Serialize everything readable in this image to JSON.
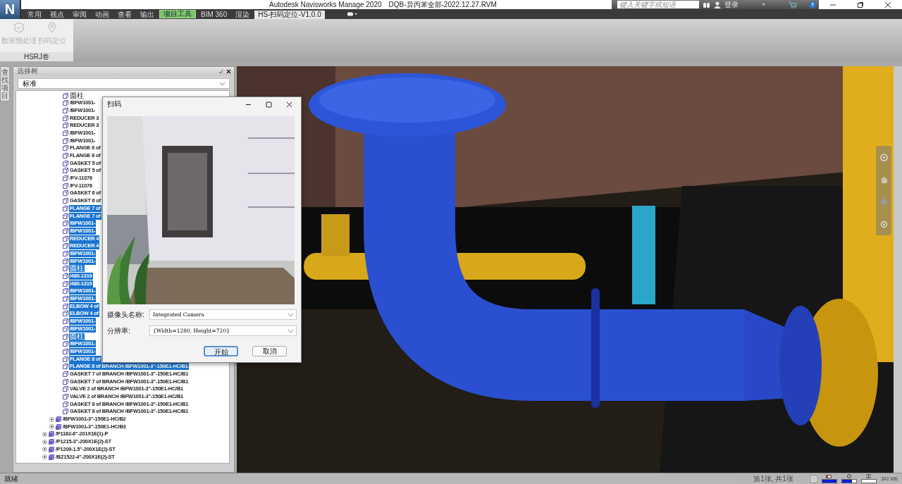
{
  "title_bar": {
    "logo": "N",
    "title": "Autodesk Navisworks Manage 2020",
    "document": "DQB-异丙苯全部-2022.12.27.RVM",
    "search": {
      "placeholder": "键入关键字或短语"
    },
    "sign_in": "登录",
    "help": "?"
  },
  "ribbon_tabs": [
    {
      "label": "常用",
      "selected": false,
      "highlighted": false
    },
    {
      "label": "视点",
      "selected": false,
      "highlighted": false
    },
    {
      "label": "审阅",
      "selected": false,
      "highlighted": false
    },
    {
      "label": "动画",
      "selected": false,
      "highlighted": false
    },
    {
      "label": "查看",
      "selected": false,
      "highlighted": false
    },
    {
      "label": "输出",
      "selected": false,
      "highlighted": false
    },
    {
      "label": "项目工具",
      "selected": false,
      "highlighted": true
    },
    {
      "label": "BIM 360",
      "selected": false,
      "highlighted": false
    },
    {
      "label": "渲染",
      "selected": false,
      "highlighted": false
    },
    {
      "label": "HS-扫码定位-V1.0.0",
      "selected": true,
      "highlighted": false
    }
  ],
  "ribbon": {
    "buttons": [
      {
        "label": "数据预处理",
        "disabled": true
      },
      {
        "label": "扫码定位",
        "disabled": true
      }
    ],
    "panel_label": "HSRJ卷"
  },
  "side_tab": "查找项目",
  "selection_tree": {
    "title": "选择树",
    "filter": "标准",
    "items": [
      {
        "children": [
          {
            "children": [
              {
                "label": "圆柱",
                "selected": false
              },
              {
                "label": "/BFW1001-",
                "selected": false
              },
              {
                "label": "/BFW1001-",
                "selected": false
              },
              {
                "label": "REDUCER 3",
                "selected": false
              },
              {
                "label": "REDUCER 3",
                "selected": false
              },
              {
                "label": "/BFW1001-",
                "selected": false
              },
              {
                "label": "/BFW1001-",
                "selected": false
              },
              {
                "label": "FLANGE 6 of",
                "selected": false
              },
              {
                "label": "FLANGE 6 of",
                "selected": false
              },
              {
                "label": "GASKET 5 of",
                "selected": false
              },
              {
                "label": "GASKET 5 of",
                "selected": false
              },
              {
                "label": "/FV-11076",
                "selected": false
              },
              {
                "label": "/FV-11076",
                "selected": false
              },
              {
                "label": "GASKET 6 of",
                "selected": false
              },
              {
                "label": "GASKET 6 of",
                "selected": false
              },
              {
                "label": "FLANGE 7 of",
                "selected": true
              },
              {
                "label": "FLANGE 7 of",
                "selected": true
              },
              {
                "label": "/BFW1001-",
                "selected": true
              },
              {
                "label": "/BFW1001-",
                "selected": true
              },
              {
                "label": "REDUCER 4",
                "selected": true
              },
              {
                "label": "REDUCER 4",
                "selected": true
              },
              {
                "label": "/BFW1001-",
                "selected": true
              },
              {
                "label": "/BFW1001-",
                "selected": true
              },
              {
                "label": "圆柱",
                "selected": true
              },
              {
                "label": "/480-1319",
                "selected": true
              },
              {
                "label": "/480-1319",
                "selected": true
              },
              {
                "label": "/BFW1001-",
                "selected": true
              },
              {
                "label": "/BFW1001-",
                "selected": true
              },
              {
                "label": "ELBOW 4 of",
                "selected": true
              },
              {
                "label": "ELBOW 4 of",
                "selected": true
              },
              {
                "label": "/BFW1001-",
                "selected": true
              },
              {
                "label": "/BFW1001-",
                "selected": true
              },
              {
                "label": "圆柱",
                "selected": true
              },
              {
                "label": "/BFW1001-",
                "selected": true
              },
              {
                "label": "/BFW1001-",
                "selected": true
              },
              {
                "label": "FLANGE 8 of",
                "selected": true
              },
              {
                "label": "FLANGE 8 of BRANCH /BFW1001-3\"-150E1-HC/B1",
                "selected": true
              },
              {
                "label": "GASKET 7 of BRANCH /BFW1001-3\"-150E1-HC/B1",
                "selected": false
              },
              {
                "label": "GASKET 7 of BRANCH /BFW1001-3\"-150E1-HC/B1",
                "selected": false
              },
              {
                "label": "VALVE 2 of BRANCH /BFW1001-3\"-150E1-HC/B1",
                "selected": false
              },
              {
                "label": "VALVE 2 of BRANCH /BFW1001-3\"-150E1-HC/B1",
                "selected": false
              },
              {
                "label": "GASKET 8 of BRANCH /BFW1001-3\"-150E1-HC/B1",
                "selected": false
              },
              {
                "label": "GASKET 8 of BRANCH /BFW1001-3\"-150E1-HC/B1",
                "selected": false
              }
            ]
          },
          {
            "label": "/BFW1001-3\"-150E1-HC/B2",
            "expanded": false
          },
          {
            "label": "/BFW1001-3\"-150E1-HC/B3",
            "expanded": false
          }
        ]
      },
      {
        "label": "/P1162-6\"-201X1E(1)-P",
        "expanded": false
      },
      {
        "label": "/P1215-3\"-200X1E(2)-ST",
        "expanded": false
      },
      {
        "label": "/P1209-1.5\"-200X1E(2)-ST",
        "expanded": false
      },
      {
        "label": "/BZ1522-4\"-200X1E(2)-ST",
        "expanded": false
      }
    ]
  },
  "dialog": {
    "title": "扫码",
    "fields": [
      {
        "label": "摄像头名称:",
        "value": "Integrated Camera"
      },
      {
        "label": "分辨率:",
        "value": "{Width=1280, Height=720}"
      }
    ],
    "buttons": [
      {
        "label": "开始",
        "kind": "primary"
      },
      {
        "label": "取消",
        "kind": "normal"
      }
    ]
  },
  "status_bar": {
    "status": "就绪",
    "page": "第1张, 共1张",
    "meters": [
      {
        "level": 1
      },
      {
        "level": 0.72
      },
      {
        "level": 0
      }
    ],
    "memory": "342 MB"
  }
}
